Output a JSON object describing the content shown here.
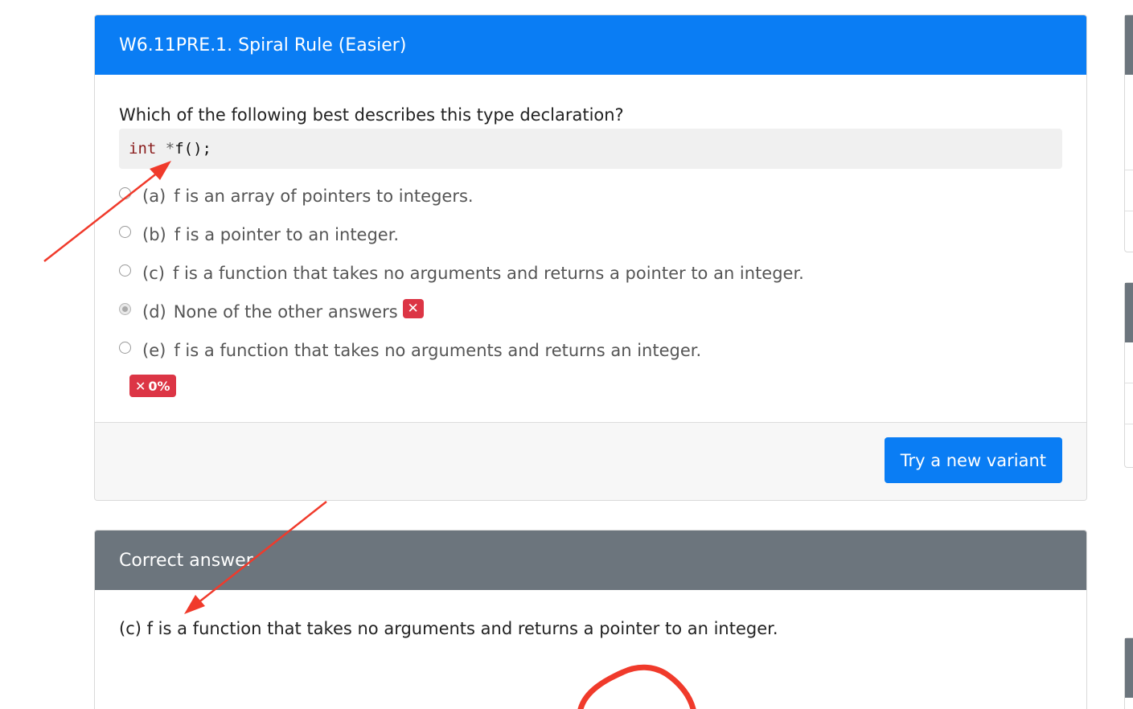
{
  "question": {
    "title": "W6.11PRE.1. Spiral Rule (Easier)",
    "prompt": "Which of the following best describes this type declaration?",
    "code": {
      "keyword": "int",
      "operator": " *",
      "identifier": "f();"
    },
    "options": [
      {
        "key": "(a)",
        "text": "f is an array of pointers to integers.",
        "selected": false
      },
      {
        "key": "(b)",
        "text": "f is a pointer to an integer.",
        "selected": false
      },
      {
        "key": "(c)",
        "text": "f is a function that takes no arguments and returns a pointer to an integer.",
        "selected": false
      },
      {
        "key": "(d)",
        "text": "None of the other answers",
        "selected": true,
        "marked_wrong": true
      },
      {
        "key": "(e)",
        "text": "f is a function that takes no arguments and returns an integer.",
        "selected": false
      }
    ],
    "wrong_mark": "✕",
    "score_icon": "✕",
    "score": "0%",
    "new_variant_label": "Try a new variant"
  },
  "correct_answer": {
    "header": "Correct answer",
    "text": "(c) f is a function that takes no arguments and returns a pointer to an integer."
  },
  "colors": {
    "primary": "#0a7df4",
    "secondary": "#6c757d",
    "danger": "#dc3545",
    "annotation": "#f03a2b"
  }
}
